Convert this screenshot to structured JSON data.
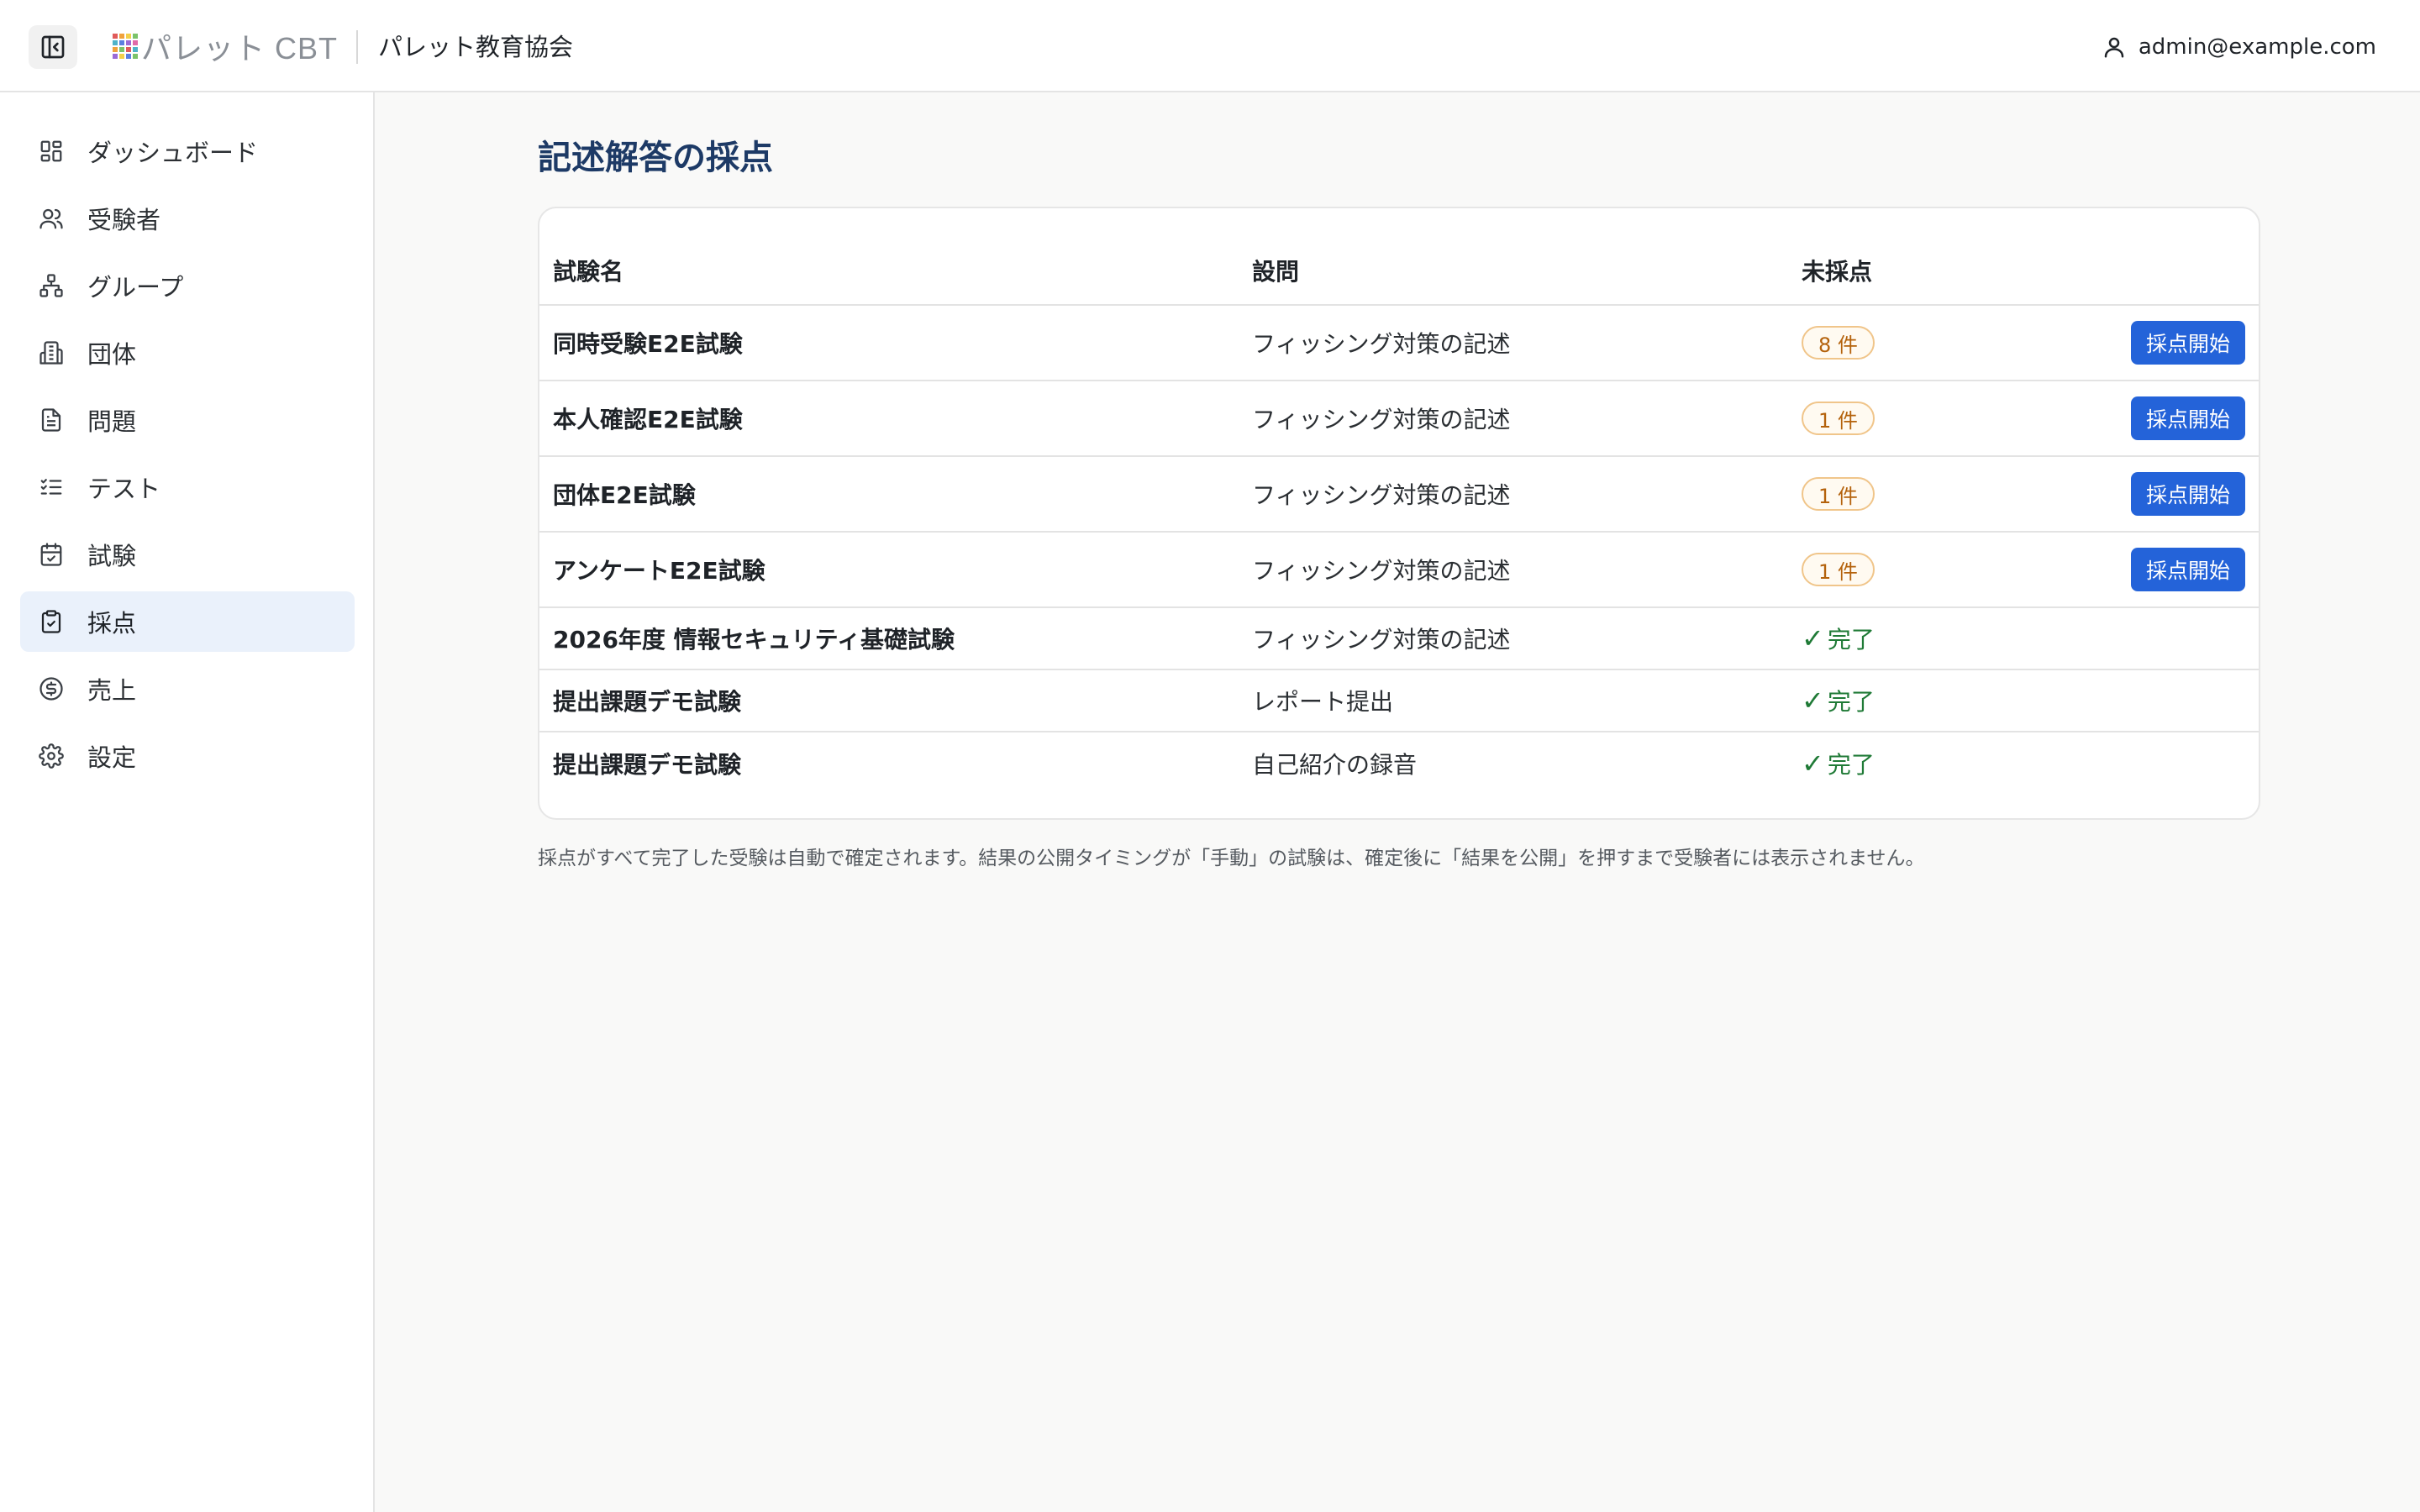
{
  "header": {
    "logo_text": "パレット CBT",
    "org_name": "パレット教育協会",
    "user_email": "admin@example.com"
  },
  "sidebar": {
    "items": [
      {
        "label": "ダッシュボード",
        "icon": "dashboard-icon",
        "active": false
      },
      {
        "label": "受験者",
        "icon": "users-icon",
        "active": false
      },
      {
        "label": "グループ",
        "icon": "group-hierarchy-icon",
        "active": false
      },
      {
        "label": "団体",
        "icon": "building-icon",
        "active": false
      },
      {
        "label": "問題",
        "icon": "document-icon",
        "active": false
      },
      {
        "label": "テスト",
        "icon": "checklist-icon",
        "active": false
      },
      {
        "label": "試験",
        "icon": "calendar-check-icon",
        "active": false
      },
      {
        "label": "採点",
        "icon": "clipboard-check-icon",
        "active": true
      },
      {
        "label": "売上",
        "icon": "dollar-circle-icon",
        "active": false
      },
      {
        "label": "設定",
        "icon": "gear-icon",
        "active": false
      }
    ]
  },
  "main": {
    "title": "記述解答の採点",
    "table": {
      "columns": [
        "試験名",
        "設問",
        "未採点"
      ],
      "rows": [
        {
          "exam": "同時受験E2E試験",
          "question": "フィッシング対策の記述",
          "pending": "8 件",
          "status": "pending",
          "action": "採点開始"
        },
        {
          "exam": "本人確認E2E試験",
          "question": "フィッシング対策の記述",
          "pending": "1 件",
          "status": "pending",
          "action": "採点開始"
        },
        {
          "exam": "団体E2E試験",
          "question": "フィッシング対策の記述",
          "pending": "1 件",
          "status": "pending",
          "action": "採点開始"
        },
        {
          "exam": "アンケートE2E試験",
          "question": "フィッシング対策の記述",
          "pending": "1 件",
          "status": "pending",
          "action": "採点開始"
        },
        {
          "exam": "2026年度 情報セキュリティ基礎試験",
          "question": "フィッシング対策の記述",
          "status": "done",
          "done_label": "完了"
        },
        {
          "exam": "提出課題デモ試験",
          "question": "レポート提出",
          "status": "done",
          "done_label": "完了"
        },
        {
          "exam": "提出課題デモ試験",
          "question": "自己紹介の録音",
          "status": "done",
          "done_label": "完了"
        }
      ]
    },
    "footnote": "採点がすべて完了した受験は自動で確定されます。結果の公開タイミングが「手動」の試験は、確定後に「結果を公開」を押すまで受験者には表示されません。"
  },
  "colors": {
    "primary_button": "#2463d9",
    "title": "#1d3a66",
    "pending_text": "#b4620c",
    "pending_border": "#f0c58a",
    "done": "#1f7a36",
    "active_nav_bg": "#eaf1fb"
  }
}
